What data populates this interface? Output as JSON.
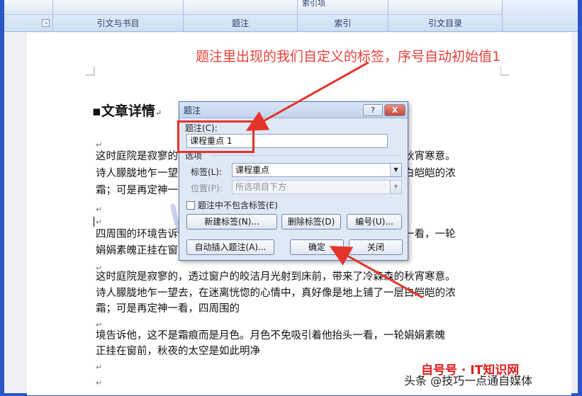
{
  "ribbon": {
    "groups": [
      {
        "label": "",
        "top_text": ""
      },
      {
        "label": "引文与书目",
        "top_text": ""
      },
      {
        "label": "题注",
        "top_text": ""
      },
      {
        "label": "索引",
        "top_text": "索引项"
      },
      {
        "label": "引文目录",
        "top_text": ""
      }
    ]
  },
  "annotation": "题注里出现的我们自定义的标签，序号自动初始值1",
  "document": {
    "heading": "文章详情",
    "para_mark": "↵",
    "lines": [
      "这时庭院是寂寥的，透过窗户的皎洁月光射到床前，带来了冷森森的秋宵寒意。",
      "诗人朦胧地乍一望去，在迷离恍惚的心情中，真好像是地上铺了一层白皑皑的浓",
      "霜；可是再定神一看，四周围的",
      "四周围的环境告诉他，这不是霜痕而是月色。月色不免吸引着他抬头一看，一轮",
      "娟娟素魄正挂在窗前，秋夜的太空是如此明净",
      "这时庭院是寂寥的，透过窗户的皎洁月光射到床前，带来了冷森森的秋宵寒意。",
      "诗人朦胧地乍一望去，在迷离恍惚的心情中，真好像是地上铺了一层白皑皑的浓",
      "霜；可是再定神一看，四周围的",
      "境告诉他，这不是霜痕而是月色。月色不免吸引着他抬头一看，一轮娟娟素魄",
      "正挂在窗前，秋夜的太空是如此明净"
    ],
    "brand": "自号号 · IT知识网",
    "credit": "头条 @技巧一点通自媒体"
  },
  "dialog": {
    "title": "题注",
    "help": "?",
    "close": "X",
    "caption_label": "题注(C):",
    "caption_value": "课程重点 1",
    "options_label": "选项",
    "label_label": "标签(L):",
    "label_value": "课程重点",
    "position_label": "位置(P):",
    "position_value": "所选项目下方",
    "exclude_label": "题注中不包含标签(E)",
    "new_label_btn": "新建标签(N)...",
    "delete_label_btn": "删除标签(D)",
    "numbering_btn": "编号(U)...",
    "autoinsert_btn": "自动插入题注(A)...",
    "ok_btn": "确定",
    "cancel_btn": "关闭"
  },
  "colors": {
    "annotation": "#e8413a",
    "dialog_bg": "#dfe8f5",
    "frame": "#2a56c6"
  }
}
